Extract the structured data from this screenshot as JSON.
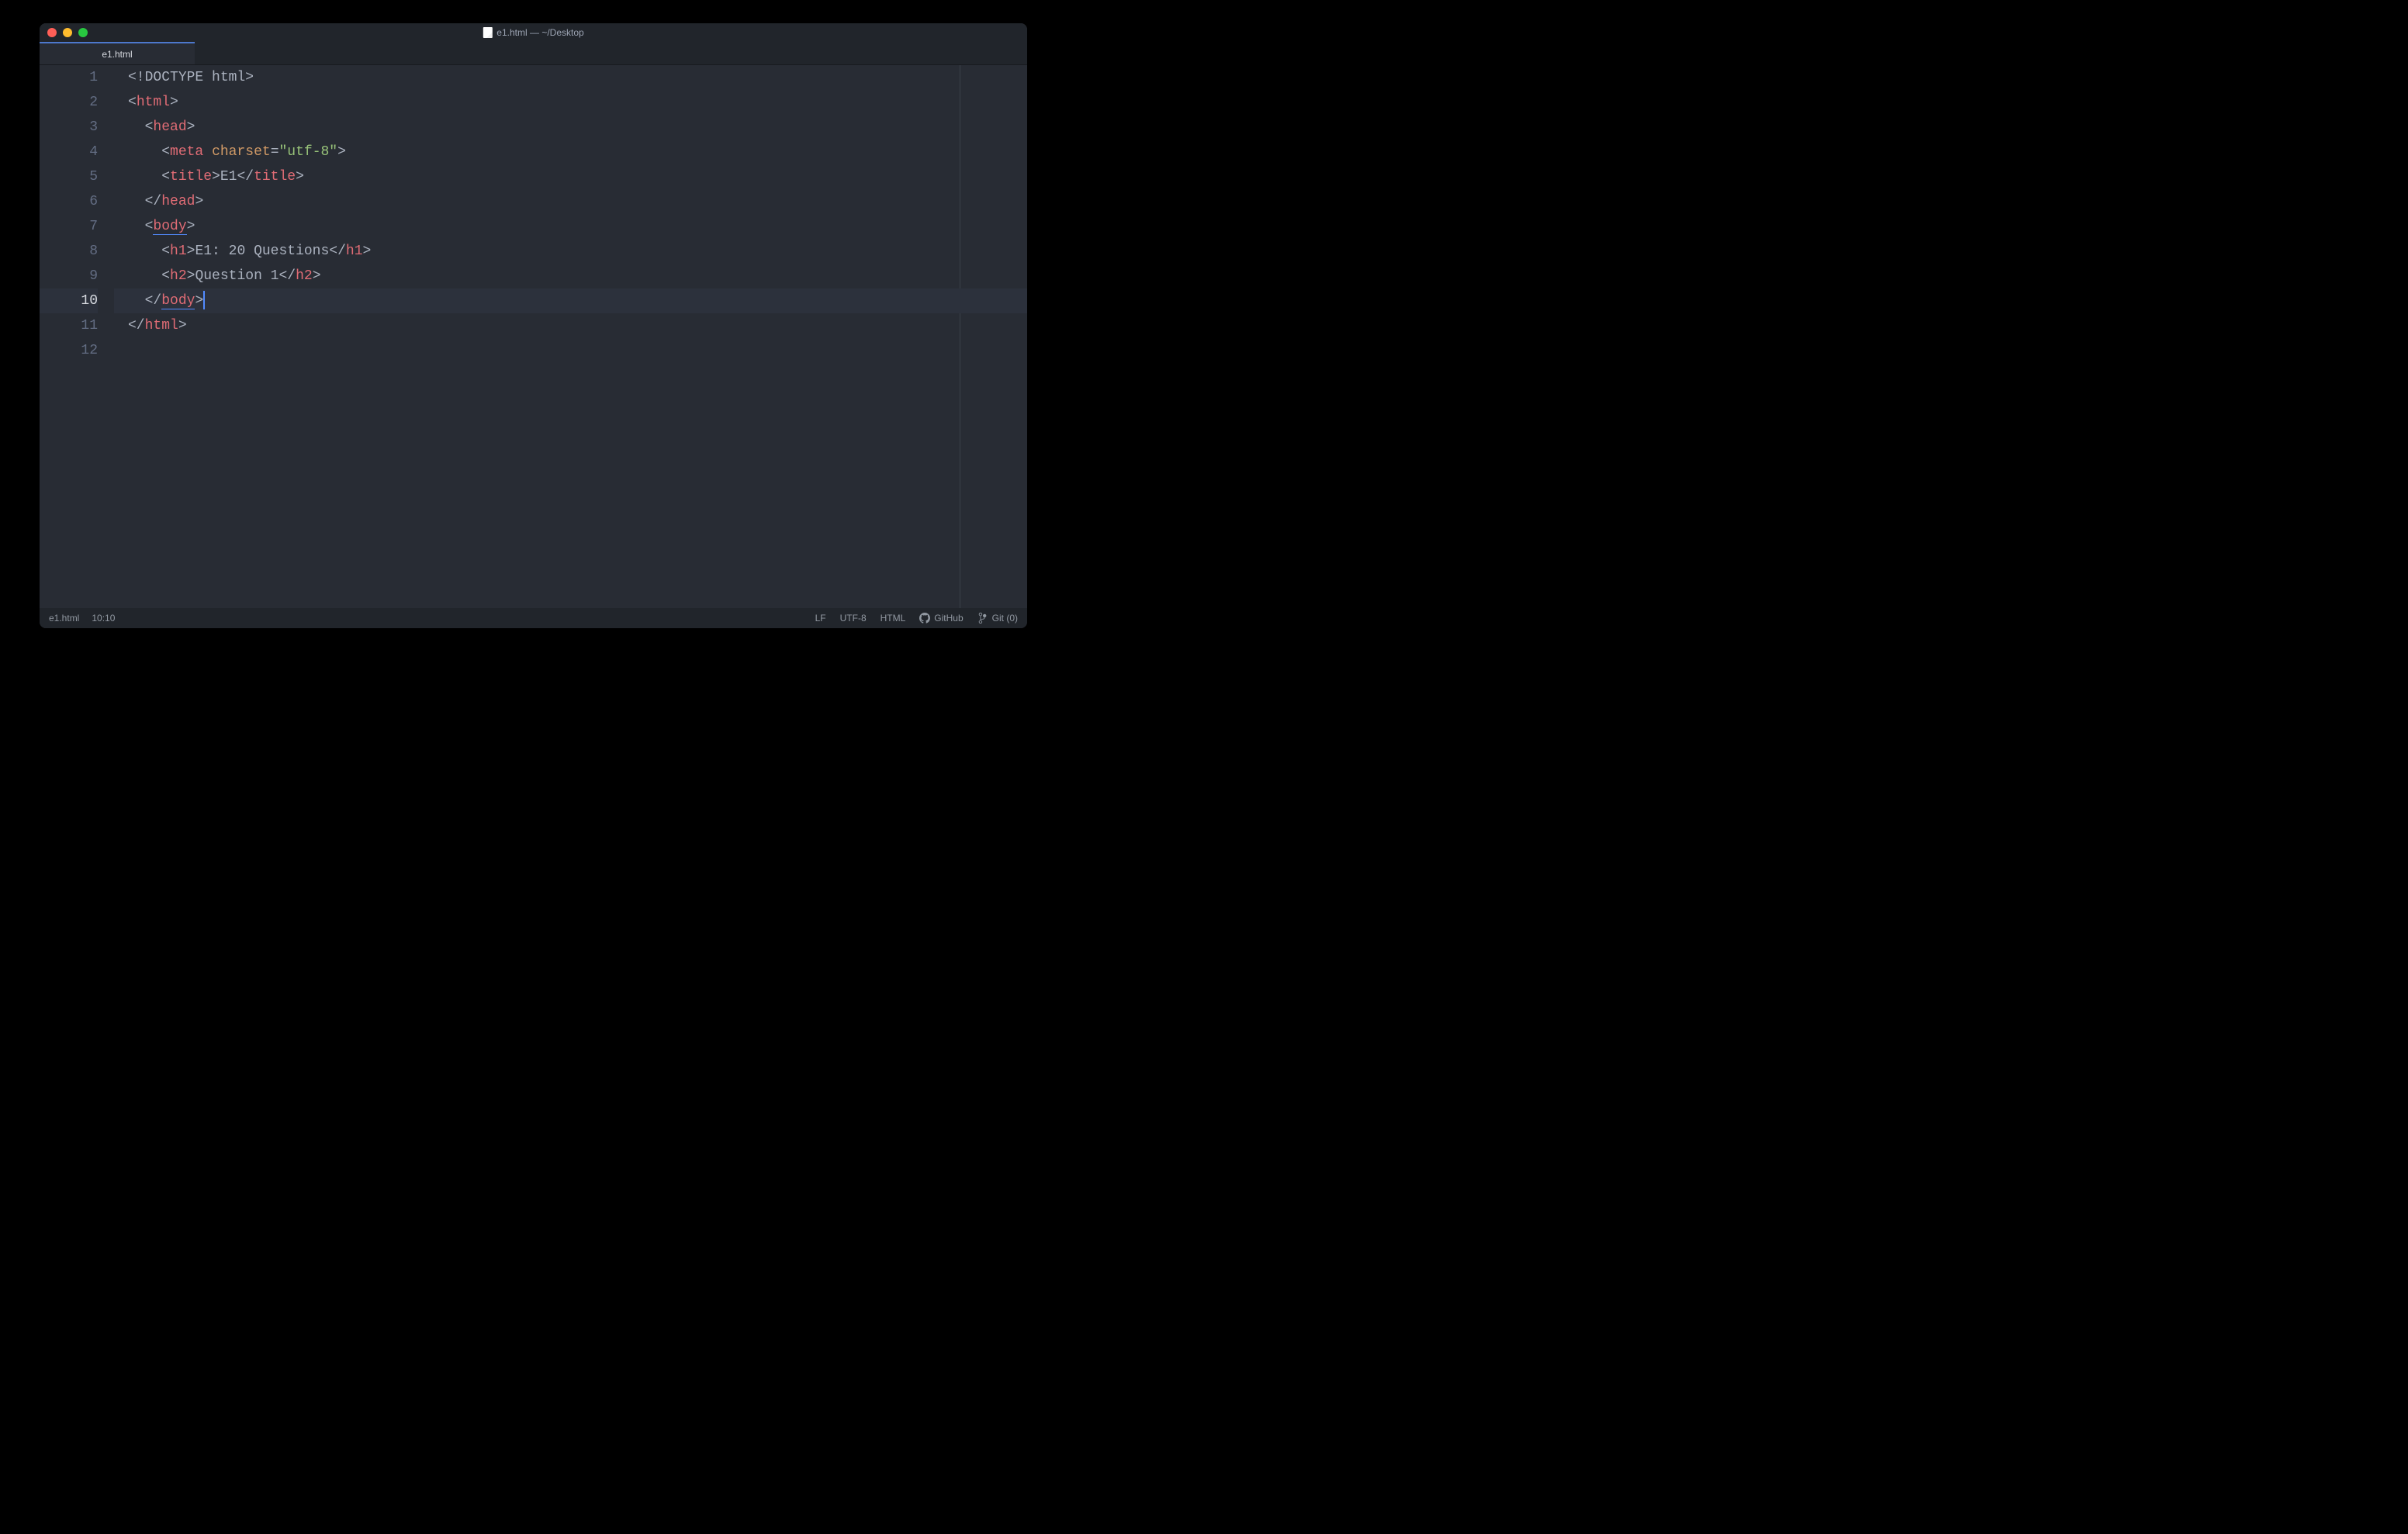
{
  "window": {
    "title": "e1.html — ~/Desktop"
  },
  "tabs": [
    {
      "label": "e1.html",
      "active": true
    }
  ],
  "editor": {
    "line_count": 12,
    "active_line": 10,
    "cursor_col": 10,
    "lines": [
      {
        "indent": 0,
        "tokens": [
          {
            "c": "p",
            "t": "<!"
          },
          {
            "c": "doctype",
            "t": "DOCTYPE html"
          },
          {
            "c": "p",
            "t": ">"
          }
        ]
      },
      {
        "indent": 0,
        "tokens": [
          {
            "c": "p",
            "t": "<"
          },
          {
            "c": "tg",
            "t": "html"
          },
          {
            "c": "p",
            "t": ">"
          }
        ]
      },
      {
        "indent": 1,
        "tokens": [
          {
            "c": "p",
            "t": "<"
          },
          {
            "c": "tg",
            "t": "head"
          },
          {
            "c": "p",
            "t": ">"
          }
        ]
      },
      {
        "indent": 2,
        "tokens": [
          {
            "c": "p",
            "t": "<"
          },
          {
            "c": "tg",
            "t": "meta"
          },
          {
            "c": "tx",
            "t": " "
          },
          {
            "c": "at",
            "t": "charset"
          },
          {
            "c": "p",
            "t": "="
          },
          {
            "c": "st",
            "t": "\"utf-8\""
          },
          {
            "c": "p",
            "t": ">"
          }
        ]
      },
      {
        "indent": 2,
        "tokens": [
          {
            "c": "p",
            "t": "<"
          },
          {
            "c": "tg",
            "t": "title"
          },
          {
            "c": "p",
            "t": ">"
          },
          {
            "c": "tx",
            "t": "E1"
          },
          {
            "c": "p",
            "t": "</"
          },
          {
            "c": "tg",
            "t": "title"
          },
          {
            "c": "p",
            "t": ">"
          }
        ]
      },
      {
        "indent": 1,
        "tokens": [
          {
            "c": "p",
            "t": "</"
          },
          {
            "c": "tg",
            "t": "head"
          },
          {
            "c": "p",
            "t": ">"
          }
        ]
      },
      {
        "indent": 1,
        "tokens": [
          {
            "c": "p",
            "t": "<"
          },
          {
            "c": "tg",
            "t": "body",
            "u": true
          },
          {
            "c": "p",
            "t": ">"
          }
        ]
      },
      {
        "indent": 2,
        "tokens": [
          {
            "c": "p",
            "t": "<"
          },
          {
            "c": "tg",
            "t": "h1"
          },
          {
            "c": "p",
            "t": ">"
          },
          {
            "c": "tx",
            "t": "E1: 20 Questions"
          },
          {
            "c": "p",
            "t": "</"
          },
          {
            "c": "tg",
            "t": "h1"
          },
          {
            "c": "p",
            "t": ">"
          }
        ]
      },
      {
        "indent": 2,
        "tokens": [
          {
            "c": "p",
            "t": "<"
          },
          {
            "c": "tg",
            "t": "h2"
          },
          {
            "c": "p",
            "t": ">"
          },
          {
            "c": "tx",
            "t": "Question 1"
          },
          {
            "c": "p",
            "t": "</"
          },
          {
            "c": "tg",
            "t": "h2"
          },
          {
            "c": "p",
            "t": ">"
          }
        ]
      },
      {
        "indent": 1,
        "tokens": [
          {
            "c": "p",
            "t": "</"
          },
          {
            "c": "tg",
            "t": "body",
            "u": true
          },
          {
            "c": "p",
            "t": ">"
          }
        ],
        "cursor_after": true
      },
      {
        "indent": 0,
        "tokens": [
          {
            "c": "p",
            "t": "</"
          },
          {
            "c": "tg",
            "t": "html"
          },
          {
            "c": "p",
            "t": ">"
          }
        ]
      },
      {
        "indent": 0,
        "tokens": []
      }
    ]
  },
  "statusbar": {
    "file": "e1.html",
    "position": "10:10",
    "eol": "LF",
    "encoding": "UTF-8",
    "language": "HTML",
    "github": "GitHub",
    "git": "Git (0)"
  }
}
